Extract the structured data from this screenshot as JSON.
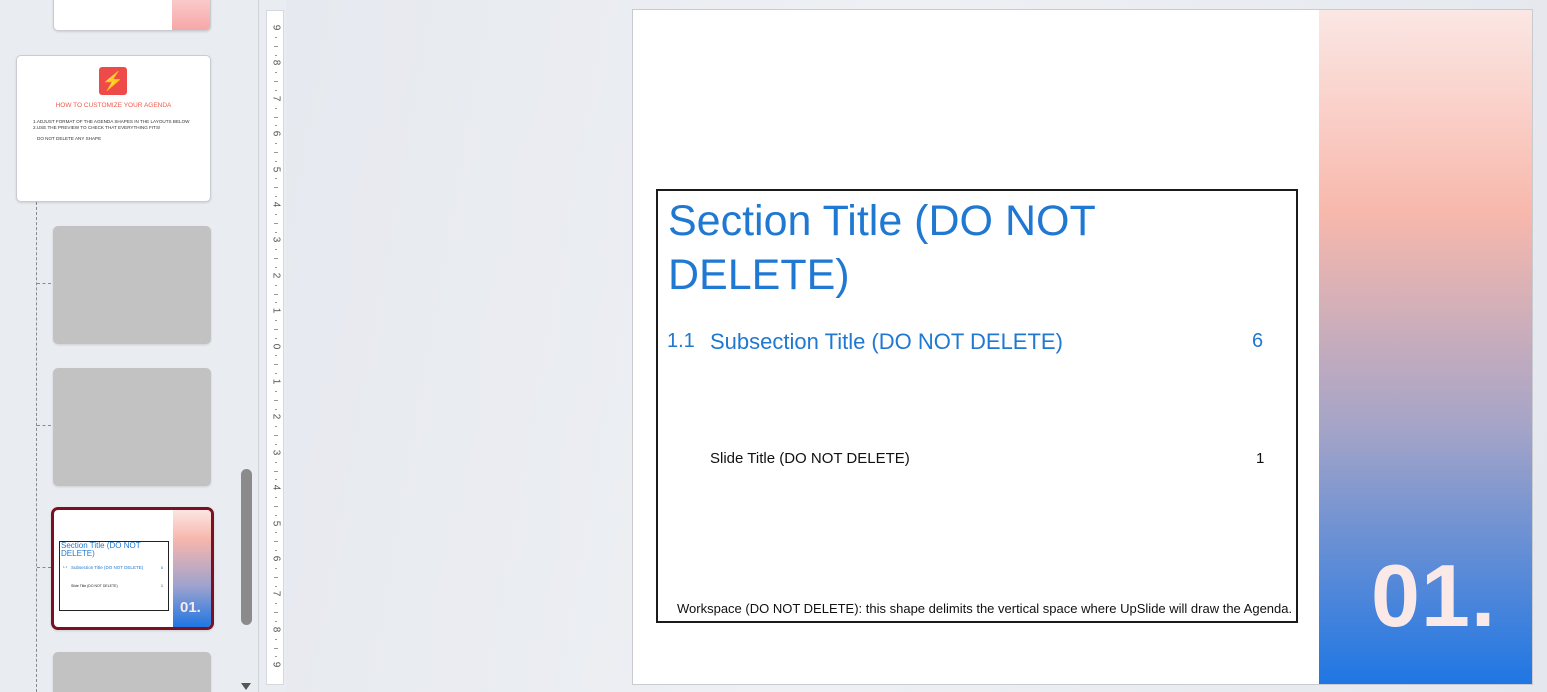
{
  "panel": {
    "agenda_thumb": {
      "title": "HOW TO CUSTOMIZE YOUR AGENDA",
      "line1": "1.ADJUST FORMAT OF THE AGENDA SHAPES IN THE LAYOUTS BELOW",
      "line2": "2.USE THE PREVIEW TO CHECK THAT EVERYTHING FITS!",
      "line3": "DO NOT DELETE ANY SHAPE",
      "logo_icon": "lightning-icon",
      "logo_color": "#ef4a4a"
    },
    "selected_thumb": {
      "section_title": "Section Title (DO NOT DELETE)",
      "sub_num": "1.1",
      "sub_title": "Subsection Title (DO NOT DELETE)",
      "sub_page": "6",
      "slide_title": "Slide Title (DO NOT DELETE)",
      "slide_page": "1",
      "number": "01.",
      "border_color": "#7a1020"
    }
  },
  "ruler": {
    "labels": [
      "9",
      "8",
      "7",
      "6",
      "5",
      "4",
      "3",
      "2",
      "1",
      "0",
      "1",
      "2",
      "3",
      "4",
      "5",
      "6",
      "7",
      "8",
      "9"
    ]
  },
  "slide": {
    "section_title": "Section Title (DO NOT DELETE)",
    "subsection_number": "1.1",
    "subsection_title": "Subsection Title (DO NOT DELETE)",
    "subsection_page": "6",
    "slide_title": "Slide Title (DO NOT DELETE)",
    "slide_page": "1",
    "workspace_note": "Workspace (DO NOT DELETE): this shape delimits the vertical space where UpSlide will draw the Agenda.",
    "number": "01.",
    "accent_color": "#1f78d1"
  }
}
